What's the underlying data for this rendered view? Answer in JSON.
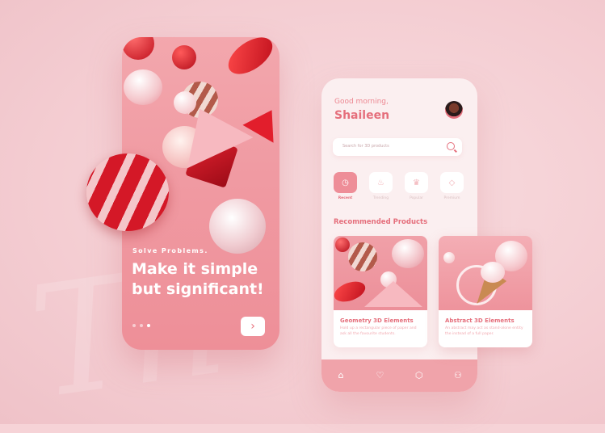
{
  "onboarding": {
    "tagline": "Solve Problems.",
    "headline": "Make it simple but significant!",
    "pager_dots": 3,
    "active_dot": 3,
    "next_icon": "chevron-right-icon"
  },
  "home": {
    "greeting": "Good morning,",
    "user_name": "Shaileen",
    "search_placeholder": "Search for 3D products",
    "categories": [
      {
        "label": "Recent",
        "icon": "clock-icon",
        "active": true
      },
      {
        "label": "Trending",
        "icon": "flame-icon",
        "active": false
      },
      {
        "label": "Popular",
        "icon": "crown-icon",
        "active": false
      },
      {
        "label": "Premium",
        "icon": "diamond-icon",
        "active": false
      }
    ],
    "section_title": "Recommended Products",
    "products": [
      {
        "title": "Geometry 3D Elements",
        "description": "Hold up a rectangular piece of paper and ask all the favourite students."
      },
      {
        "title": "Abstract 3D Elements",
        "description": "An abstract may act as stand-alone entity the instead of a full paper."
      }
    ],
    "tabs": [
      {
        "icon": "home-icon"
      },
      {
        "icon": "heart-icon"
      },
      {
        "icon": "box-icon"
      },
      {
        "icon": "user-icon"
      }
    ]
  },
  "colors": {
    "accent": "#e56f7c",
    "background": "#f6d3d7",
    "phone_bg": "#f09aa2"
  }
}
